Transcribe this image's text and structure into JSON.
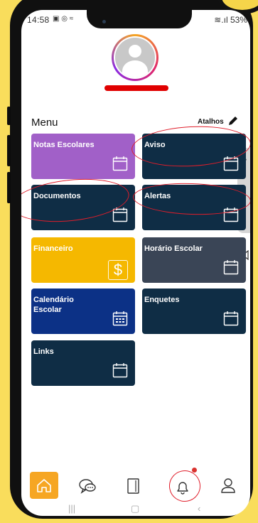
{
  "status_bar": {
    "time": "14:58",
    "icons_left": "▣ ◎ ≈",
    "battery": "≋.ıl 53%"
  },
  "profile": {
    "avatar_icon": "user-avatar-icon",
    "name_redacted": true
  },
  "menu": {
    "title": "Menu",
    "shortcuts_label": "Atalhos",
    "shortcuts_icon": "pencil-icon"
  },
  "tiles": [
    {
      "label": "Notas Escolares",
      "color": "#a160c8",
      "icon": "calendar-icon"
    },
    {
      "label": "Aviso",
      "color": "#0f2d45",
      "icon": "calendar-icon"
    },
    {
      "label": "Documentos",
      "color": "#0f2d45",
      "icon": "calendar-icon"
    },
    {
      "label": "Alertas",
      "color": "#0f2d45",
      "icon": "calendar-icon"
    },
    {
      "label": "Financeiro",
      "color": "#f5b800",
      "icon": "dollar-icon"
    },
    {
      "label": "Horário Escolar",
      "color": "#3a4556",
      "icon": "calendar-icon"
    },
    {
      "label": "Calendário Escolar",
      "color": "#0c3186",
      "icon": "calendar-grid-icon"
    },
    {
      "label": "Enquetes",
      "color": "#0f2d45",
      "icon": "calendar-icon"
    },
    {
      "label": "Links",
      "color": "#0f2d45",
      "icon": "calendar-icon"
    }
  ],
  "bottom_nav": {
    "items": [
      "home-icon",
      "chat-icon",
      "book-icon",
      "bell-icon",
      "profile-icon"
    ],
    "active": "home-icon",
    "bell_has_notification": true,
    "accent": "#f6a623"
  },
  "annotation_color": "#e01e2b"
}
